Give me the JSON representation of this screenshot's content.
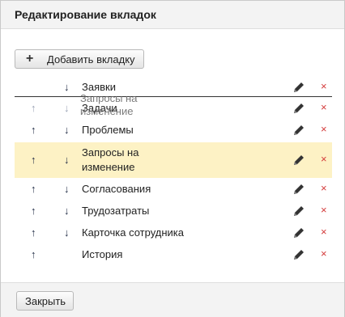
{
  "dialog": {
    "title": "Редактирование вкладок",
    "add_label": "Добавить вкладку",
    "close_label": "Закрыть"
  },
  "tabs": [
    {
      "label": "Заявки",
      "move_up": false,
      "move_down": true,
      "highlighted": false
    },
    {
      "label": "Задачи",
      "move_up": true,
      "move_down": true,
      "highlighted": false,
      "faded": true
    },
    {
      "label": "Проблемы",
      "move_up": true,
      "move_down": true,
      "highlighted": false
    },
    {
      "label": "Запросы на изменение",
      "move_up": true,
      "move_down": true,
      "highlighted": true
    },
    {
      "label": "Согласования",
      "move_up": true,
      "move_down": true,
      "highlighted": false
    },
    {
      "label": "Трудозатраты",
      "move_up": true,
      "move_down": true,
      "highlighted": false
    },
    {
      "label": "Карточка сотрудника",
      "move_up": true,
      "move_down": true,
      "highlighted": false
    },
    {
      "label": "История",
      "move_up": true,
      "move_down": false,
      "highlighted": false
    }
  ],
  "drag_ghost": {
    "label": "Запросы на изменение"
  },
  "glyphs": {
    "up": "↑",
    "down": "↓",
    "delete": "×",
    "plus": "+"
  },
  "colors": {
    "highlight": "#fdf2c5",
    "delete": "#d43b3b",
    "arrow": "#1f2a44"
  }
}
